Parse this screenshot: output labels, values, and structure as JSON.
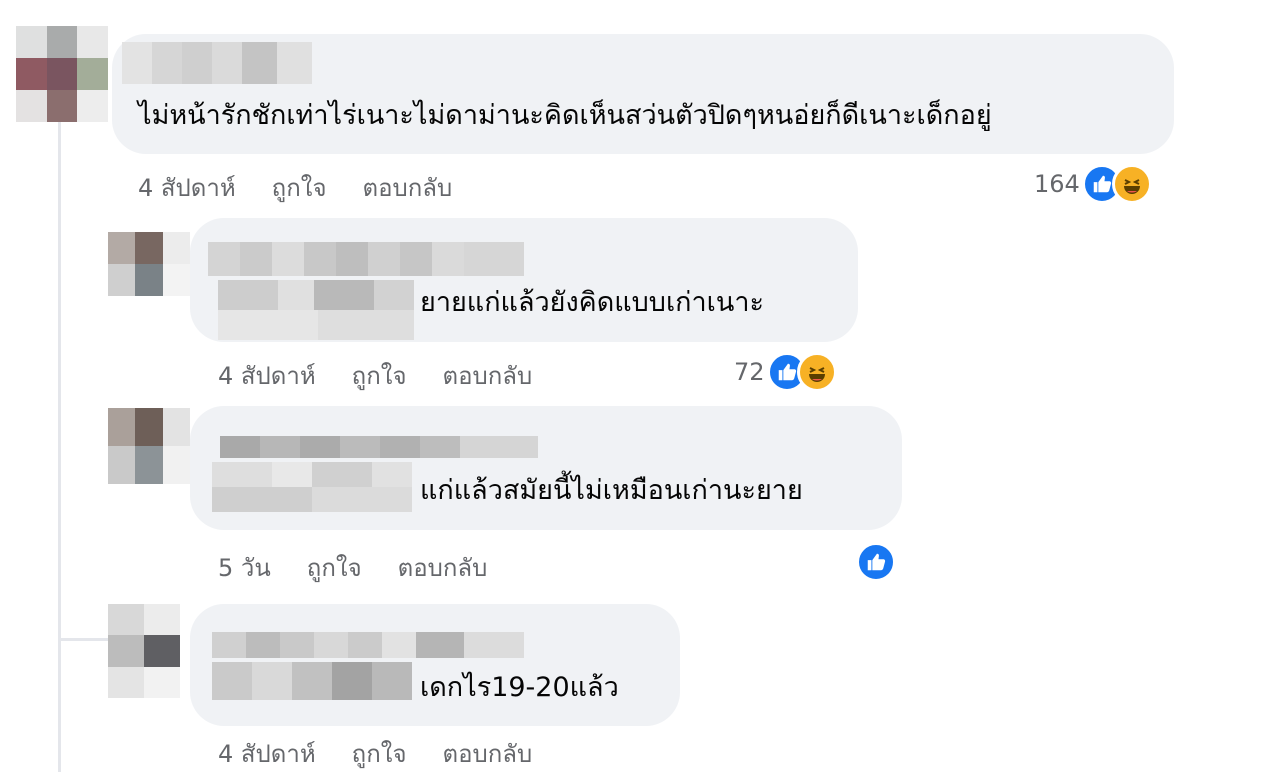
{
  "comments": [
    {
      "text": "ไม่หน้ารักชักเท่าไร่เนาะไม่ดาม่านะคิดเห็นสว่นตัวปิดๆหนอ่ยก็ดีเนาะเด็กอยู่",
      "time": "4 สัปดาห์",
      "like_label": "ถูกใจ",
      "reply_label": "ตอบกลับ",
      "reaction_count": "164",
      "reactions": [
        "like-icon",
        "haha-icon"
      ]
    },
    {
      "text": "ยายแก่แล้วยังคิดแบบเก่าเนาะ",
      "time": "4 สัปดาห์",
      "like_label": "ถูกใจ",
      "reply_label": "ตอบกลับ",
      "reaction_count": "72",
      "reactions": [
        "like-icon",
        "haha-icon"
      ]
    },
    {
      "text": "แก่แล้วสมัยนี้ไม่เหมือนเก่านะยาย",
      "time": "5 วัน",
      "like_label": "ถูกใจ",
      "reply_label": "ตอบกลับ",
      "reaction_count": "",
      "reactions": [
        "like-icon"
      ]
    },
    {
      "text": "เดกไร19-20แล้ว",
      "time": "4 สัปดาห์",
      "like_label": "ถูกใจ",
      "reply_label": "ตอบกลับ"
    }
  ],
  "colors": {
    "bubble": "#f0f2f5",
    "meta_text": "#65676b",
    "like_blue": "#1877f2",
    "haha_yellow": "#f7b125"
  }
}
